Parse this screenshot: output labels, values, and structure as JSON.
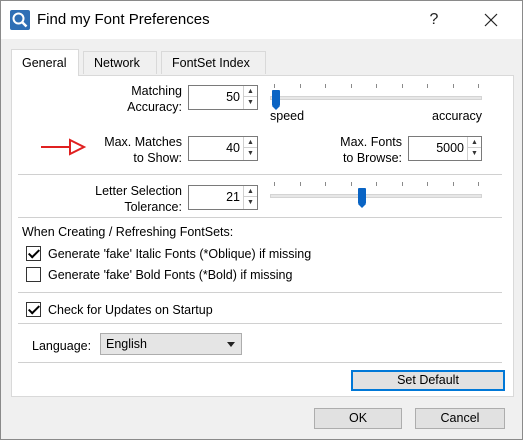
{
  "window": {
    "title": "Find my Font Preferences",
    "help_glyph": "?",
    "close_glyph": "✕",
    "app_icon": "magnifier-app-icon"
  },
  "tabs": [
    {
      "label": "General",
      "active": true
    },
    {
      "label": "Network",
      "active": false
    },
    {
      "label": "FontSet Index",
      "active": false
    }
  ],
  "general": {
    "matching": {
      "label_line1": "Matching",
      "label_line2": "Accuracy:",
      "value": "50",
      "slider_min_label": "speed",
      "slider_max_label": "accuracy",
      "slider_position": 0.0
    },
    "max_matches": {
      "label_line1": "Max. Matches",
      "label_line2": "to Show:",
      "value": "40"
    },
    "max_fonts": {
      "label_line1": "Max. Fonts",
      "label_line2": "to Browse:",
      "value": "5000"
    },
    "letter_selection": {
      "label_line1": "Letter Selection",
      "label_line2": "Tolerance:",
      "value": "21",
      "slider_position": 0.42
    },
    "fontsets_heading": "When Creating / Refreshing FontSets:",
    "fake_italic": {
      "label": "Generate 'fake' Italic Fonts (*Oblique) if missing",
      "checked": true
    },
    "fake_bold": {
      "label": "Generate 'fake' Bold Fonts (*Bold) if missing",
      "checked": false
    },
    "check_updates": {
      "label": "Check for Updates on Startup",
      "checked": true
    },
    "language": {
      "label": "Language:",
      "selected": "English"
    },
    "set_default_label": "Set Default"
  },
  "footer": {
    "ok_label": "OK",
    "cancel_label": "Cancel"
  },
  "annotation": {
    "arrow_color": "#e02020"
  },
  "colors": {
    "slider_thumb": "#0a64c4",
    "default_button_border": "#0078d7"
  }
}
